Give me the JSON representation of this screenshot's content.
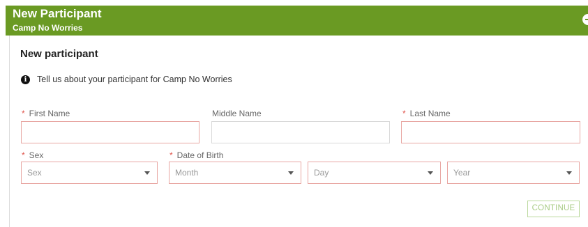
{
  "header": {
    "title": "New Participant",
    "subtitle": "Camp No Worries",
    "icon": "user-circle-icon"
  },
  "form": {
    "title": "New participant",
    "info_text": "Tell us about your participant for Camp No Worries",
    "required_marker": "*",
    "fields": {
      "first_name": {
        "label": "First Name",
        "value": ""
      },
      "middle_name": {
        "label": "Middle Name",
        "value": ""
      },
      "last_name": {
        "label": "Last Name",
        "value": ""
      },
      "sex": {
        "label": "Sex",
        "selected": "Sex"
      },
      "date_of_birth": {
        "label": "Date of Birth",
        "month": "Month",
        "day": "Day",
        "year": "Year"
      }
    },
    "continue_label": "CONTINUE"
  },
  "colors": {
    "header_bg": "#6a9a23",
    "required_border": "#e8a6a2",
    "required_star": "#e0554c",
    "button_border": "#b9d89b"
  }
}
